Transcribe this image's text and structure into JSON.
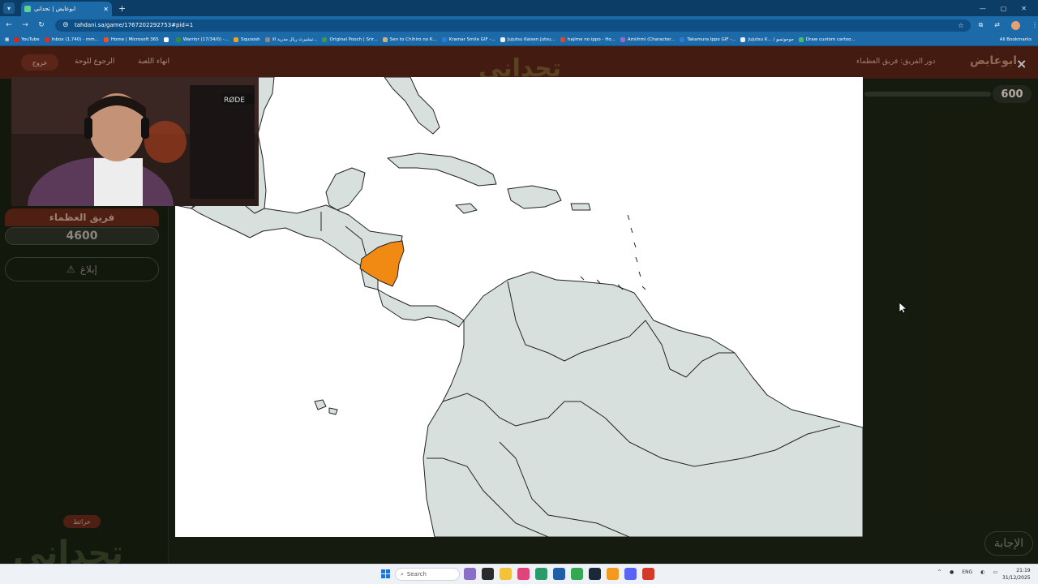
{
  "browser": {
    "tab_title": "ابوعايض | تحداني",
    "url": "tahdani.sa/game/1767202292753#pid=1",
    "bookmarks": [
      {
        "label": "YouTube",
        "color": "#e62117"
      },
      {
        "label": "Inbox (1,740) - mm...",
        "color": "#d93025"
      },
      {
        "label": "Home | Microsoft 365",
        "color": "#f25022"
      },
      {
        "label": "",
        "color": "#ffffff"
      },
      {
        "label": "Warrior (17/34/0) -...",
        "color": "#2f8f3a"
      },
      {
        "label": "Squoosh",
        "color": "#f0a020"
      },
      {
        "label": "تيشيرت ريال مدريد الا...",
        "color": "#8a8a8a"
      },
      {
        "label": "Original Pooch | Srir...",
        "color": "#3c9a4b"
      },
      {
        "label": "Sen to Chihiro no K...",
        "color": "#c7b08a"
      },
      {
        "label": "Kramar Smile GIF -...",
        "color": "#2b7bd6"
      },
      {
        "label": "Jujutsu Kaisen Jutsu...",
        "color": "#f0f0f0"
      },
      {
        "label": "hajime no ippo - Ho...",
        "color": "#d64a3a"
      },
      {
        "label": "Amiihmi (Character...",
        "color": "#9a6acb"
      },
      {
        "label": "Takamura Ippo GIF -...",
        "color": "#2b7bd6"
      },
      {
        "label": "Jujutsu K... / جوجوتسو",
        "color": "#f0f0f0"
      },
      {
        "label": "Draw custom cartoo...",
        "color": "#3fbf6f"
      }
    ],
    "all_bookmarks_label": "All Bookmarks"
  },
  "game": {
    "exit_label": "خروج",
    "back_label": "الرجوع للوحة",
    "end_label": "انهاء اللعبة",
    "logo_text": "تحداني",
    "turn_label": "دور الفريق: فريق العظماء",
    "player_name": "ابوعايض",
    "close_icon": "×",
    "question_points": "600",
    "team_name": "فريق العظماء",
    "team_score": "4600",
    "report_label": "إبلاغ",
    "report_icon": "⚠",
    "category_label": "خرائط",
    "answer_label": "الإجابة",
    "highlight_color": "#f08a13",
    "land_color": "#d8e0de"
  },
  "taskbar": {
    "search_placeholder": "Search",
    "lang": "ENG",
    "time": "21:19",
    "date": "31/12/2025"
  }
}
